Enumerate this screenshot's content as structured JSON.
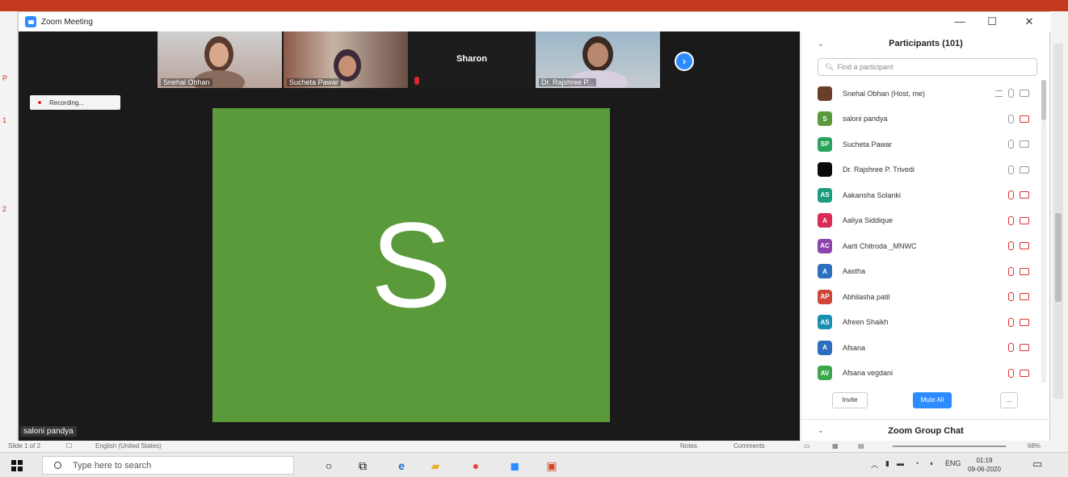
{
  "window": {
    "title": "Zoom Meeting",
    "min": "—",
    "max": "☐",
    "close": "✕"
  },
  "gallery": {
    "tiles": [
      "Snehal Obhan",
      "Sucheta Pawar",
      "Sharon",
      "Dr. Rajshree P..."
    ],
    "next_label": "›"
  },
  "recording": "Recording...",
  "active_speaker": {
    "initial": "S",
    "name": "saloni pandya",
    "color": "#5b9a3b"
  },
  "participants": {
    "title": "Participants (101)",
    "search_placeholder": "Find a participant",
    "items": [
      {
        "initials": "",
        "name": "Snehal Obhan (Host, me)",
        "color": "#6b3e2a",
        "mic": "on",
        "cam": "on",
        "more": true
      },
      {
        "initials": "S",
        "name": "saloni pandya",
        "color": "#5b9a3b",
        "mic": "on",
        "cam": "off"
      },
      {
        "initials": "SP",
        "name": "Sucheta Pawar",
        "color": "#28a35a",
        "mic": "on",
        "cam": "on"
      },
      {
        "initials": "",
        "name": "Dr. Rajshree P. Trivedi",
        "color": "#0a0a0a",
        "mic": "on",
        "cam": "on"
      },
      {
        "initials": "AS",
        "name": "Aakansha Solanki",
        "color": "#1b9c7c",
        "mic": "off",
        "cam": "off"
      },
      {
        "initials": "A",
        "name": "Aaliya Siddique",
        "color": "#d92d55",
        "mic": "off",
        "cam": "off"
      },
      {
        "initials": "AC",
        "name": "Aarti Chitroda _MNWC",
        "color": "#8e44ad",
        "mic": "off",
        "cam": "off"
      },
      {
        "initials": "A",
        "name": "Aastha",
        "color": "#2d6fbf",
        "mic": "off",
        "cam": "off"
      },
      {
        "initials": "AP",
        "name": "Abhilasha patil",
        "color": "#d0453a",
        "mic": "off",
        "cam": "off"
      },
      {
        "initials": "AS",
        "name": "Afreen Shaikh",
        "color": "#1b8fb0",
        "mic": "off",
        "cam": "off"
      },
      {
        "initials": "A",
        "name": "Afsana",
        "color": "#2d6fbf",
        "mic": "off",
        "cam": "off"
      },
      {
        "initials": "AV",
        "name": "Afsana vegdani",
        "color": "#3aa84a",
        "mic": "off",
        "cam": "off"
      }
    ],
    "invite_label": "Invite",
    "mute_all_label": "Mute All",
    "more_label": "..."
  },
  "chat": {
    "title": "Zoom Group Chat"
  },
  "ppt_status": {
    "slide": "Slide 1 of 2",
    "language": "English (United States)",
    "notes": "Notes",
    "comments": "Comments",
    "zoom": "68%"
  },
  "taskbar": {
    "search_placeholder": "Type here to search",
    "lang": "ENG",
    "time": "01:19",
    "date": "09-06-2020"
  }
}
